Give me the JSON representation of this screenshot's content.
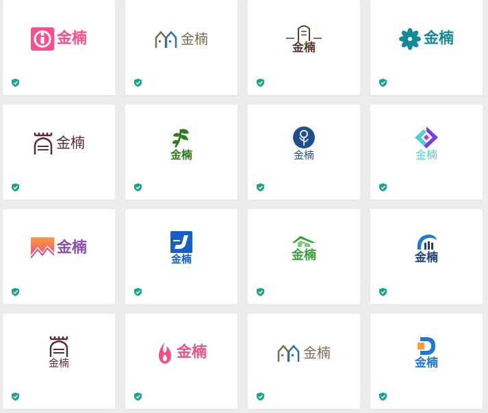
{
  "brand_text": "金楠",
  "colors": {
    "background": "#ececec",
    "card": "#ffffff",
    "badge": "#1aa58a"
  },
  "cards": [
    {
      "mark": "pink-i-square-icon",
      "brand_color": "#ff4d8d"
    },
    {
      "mark": "twin-houses-icon",
      "brand_color": "#7a6a4f"
    },
    {
      "mark": "gate-icon",
      "brand_color": "#5a3a2e"
    },
    {
      "mark": "teal-flower-icon",
      "brand_color": "#138a9a"
    },
    {
      "mark": "castle-icon",
      "brand_color": "#5a2a35"
    },
    {
      "mark": "leaf-tree-icon",
      "brand_color": "#2f7d1f"
    },
    {
      "mark": "blue-circle-rose-icon",
      "brand_color": "#1f4f8c"
    },
    {
      "mark": "purple-diamond-icon",
      "brand_color": "#4ad6d0"
    },
    {
      "mark": "sunset-house-icon",
      "brand_color": "#8a4fb0"
    },
    {
      "mark": "blue-j-square-icon",
      "brand_color": "#1460c8"
    },
    {
      "mark": "green-roof-icon",
      "brand_color": "#3aa23a"
    },
    {
      "mark": "blue-arc-icon",
      "brand_color": "#1d3e7e"
    },
    {
      "mark": "tower-icon",
      "brand_color": "#5a2a35"
    },
    {
      "mark": "pink-flame-icon",
      "brand_color": "#f0508a"
    },
    {
      "mark": "twin-houses-icon",
      "brand_color": "#7a6a4f"
    },
    {
      "mark": "blue-d-icon",
      "brand_color": "#1e78d8"
    }
  ]
}
